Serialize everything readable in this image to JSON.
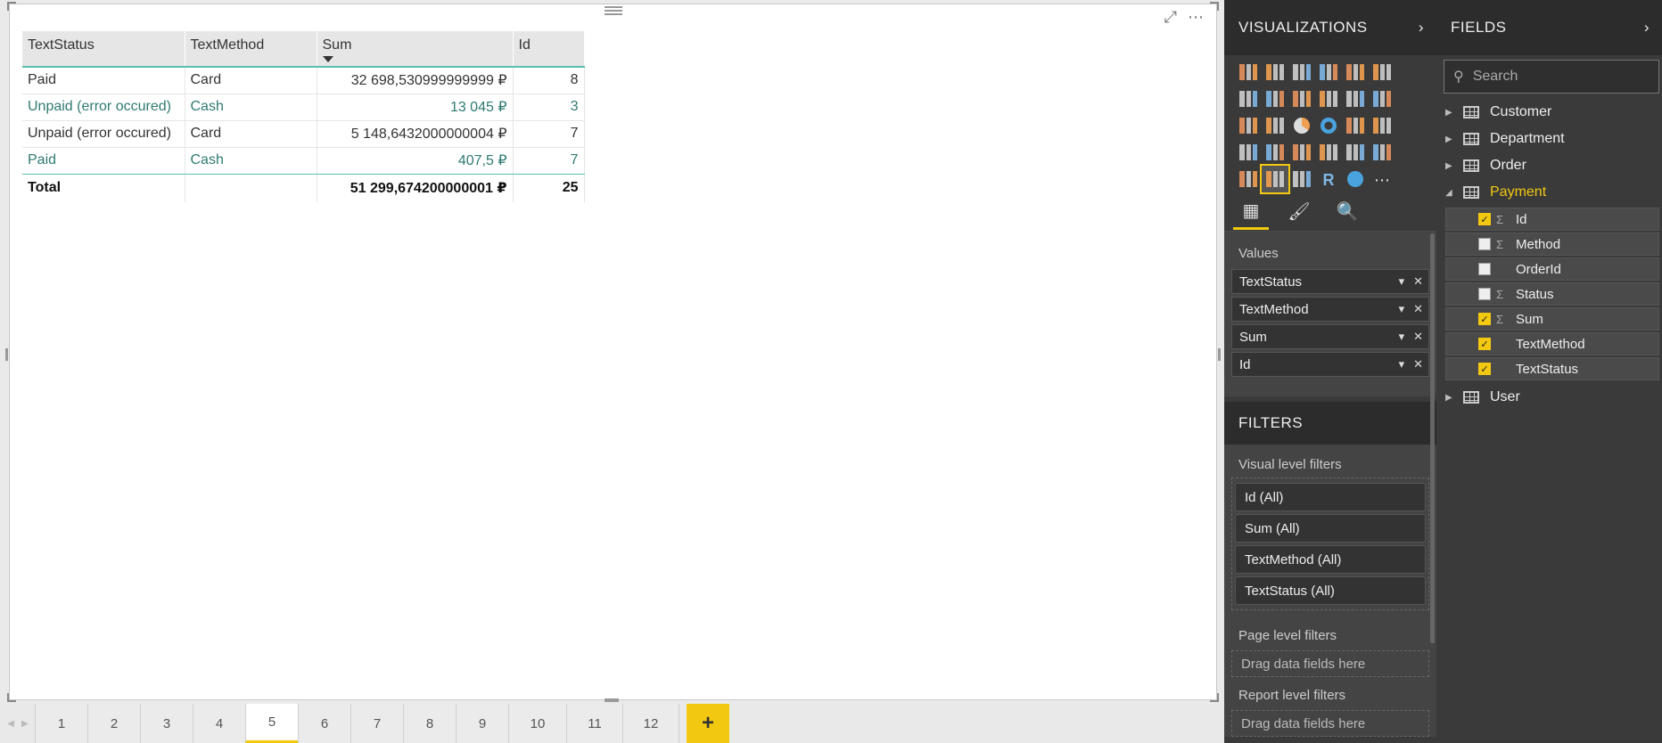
{
  "table": {
    "columns": [
      "TextStatus",
      "TextMethod",
      "Sum",
      "Id"
    ],
    "rows": [
      {
        "status": "Paid",
        "method": "Card",
        "sum": "32 698,530999999999 ₽",
        "id": "8"
      },
      {
        "status": "Unpaid (error occured)",
        "method": "Cash",
        "sum": "13 045 ₽",
        "id": "3"
      },
      {
        "status": "Unpaid (error occured)",
        "method": "Card",
        "sum": "5 148,6432000000004 ₽",
        "id": "7"
      },
      {
        "status": "Paid",
        "method": "Cash",
        "sum": "407,5 ₽",
        "id": "7"
      }
    ],
    "total": {
      "label": "Total",
      "sum": "51 299,674200000001 ₽",
      "id": "25"
    }
  },
  "pages": {
    "tabs": [
      "1",
      "2",
      "3",
      "4",
      "5",
      "6",
      "7",
      "8",
      "9",
      "10",
      "11",
      "12"
    ],
    "active": "5",
    "add": "+"
  },
  "visualizations": {
    "title": "VISUALIZATIONS",
    "values_label": "Values",
    "wells": [
      "TextStatus",
      "TextMethod",
      "Sum",
      "Id"
    ],
    "icons": [
      "stacked-bar",
      "stacked-column",
      "clustered-bar",
      "clustered-column",
      "100-bar",
      "100-column",
      "line",
      "area",
      "stacked-area",
      "line-column",
      "line-clustered",
      "ribbon",
      "waterfall",
      "scatter",
      "pie",
      "donut",
      "treemap",
      "map",
      "filled-map",
      "funnel",
      "gauge",
      "card",
      "multirow-card",
      "kpi",
      "slicer",
      "table",
      "matrix",
      "r-script",
      "globe",
      "more"
    ]
  },
  "filters": {
    "title": "FILTERS",
    "visual_level": "Visual level filters",
    "chips": [
      "Id  (All)",
      "Sum  (All)",
      "TextMethod  (All)",
      "TextStatus  (All)"
    ],
    "page_level": "Page level filters",
    "report_level": "Report level filters",
    "drag": "Drag data fields here"
  },
  "fields": {
    "title": "FIELDS",
    "search_placeholder": "Search",
    "tables": [
      "Customer",
      "Department",
      "Order",
      "Payment"
    ],
    "payment_fields": [
      {
        "name": "Id",
        "checked": true,
        "sigma": true
      },
      {
        "name": "Method",
        "checked": false,
        "sigma": true
      },
      {
        "name": "OrderId",
        "checked": false,
        "sigma": false
      },
      {
        "name": "Status",
        "checked": false,
        "sigma": true
      },
      {
        "name": "Sum",
        "checked": true,
        "sigma": true
      },
      {
        "name": "TextMethod",
        "checked": true,
        "sigma": false
      },
      {
        "name": "TextStatus",
        "checked": true,
        "sigma": false
      }
    ],
    "after": "User"
  },
  "colors": {
    "accent": "#f2c811",
    "teal": "#2f7a72",
    "panel": "#3a3a3a"
  }
}
